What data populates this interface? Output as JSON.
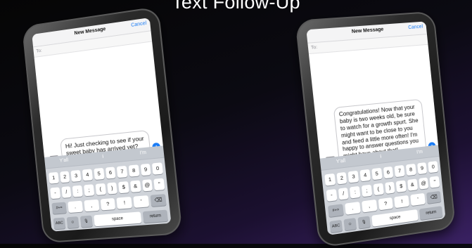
{
  "slide_title": "Text Follow-Up",
  "phones": [
    {
      "header_title": "New Message",
      "cancel_label": "Cancel",
      "to_label": "To:",
      "message": "Hi! Just checking to see if your sweet baby has arrived yet?",
      "suggestions": [
        "Y'all",
        "I",
        "I'm"
      ]
    },
    {
      "header_title": "New Message",
      "cancel_label": "Cancel",
      "to_label": "To:",
      "message": "Congratulations! Now that your baby is two weeks old, be sure to watch for a growth spurt. She might want to be close to you and feed a little more often! I'm happy to answer questions you might have about that!",
      "suggestions": [
        "Y'all",
        "I",
        "I'm"
      ]
    }
  ],
  "keyboard": {
    "row1": [
      "1",
      "2",
      "3",
      "4",
      "5",
      "6",
      "7",
      "8",
      "9",
      "0"
    ],
    "row2": [
      "-",
      "/",
      ":",
      ";",
      "(",
      ")",
      "$",
      "&",
      "@",
      "\""
    ],
    "row3": [
      "#+=",
      ".",
      ",",
      "?",
      "!",
      "'",
      "⌫"
    ],
    "row4": [
      "ABC",
      "☺",
      "🎙",
      "space",
      "return"
    ]
  },
  "colors": {
    "accent": "#1a7cf5",
    "background_glow": "#3a2163"
  }
}
